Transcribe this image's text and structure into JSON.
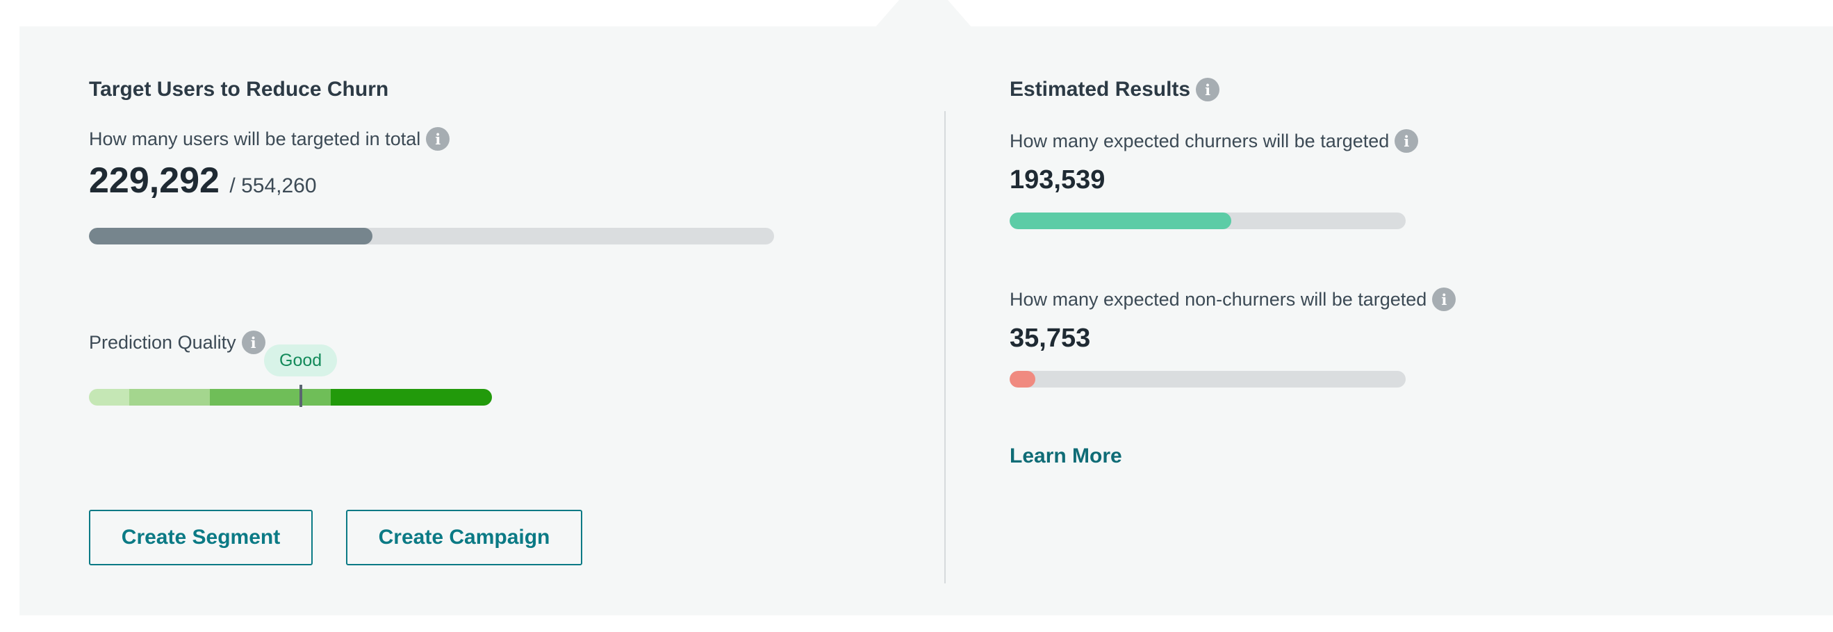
{
  "left": {
    "title": "Target Users to Reduce Churn",
    "targeted_label": "How many users will be targeted in total",
    "targeted_value": "229,292",
    "targeted_total": "/ 554,260",
    "targeted_fraction": 0.414,
    "quality_label": "Prediction Quality",
    "quality_badge": "Good",
    "quality_level": 0.525,
    "quality_segments": [
      "#c5e7b5",
      "#a4d68e",
      "#6fbe58",
      "#229a0b"
    ],
    "create_segment_label": "Create Segment",
    "create_campaign_label": "Create Campaign"
  },
  "right": {
    "title": "Estimated Results",
    "churners_label": "How many expected churners will be targeted",
    "churners_value": "193,539",
    "churners_fraction": 0.56,
    "nonchurners_label": "How many expected non-churners will be targeted",
    "nonchurners_value": "35,753",
    "nonchurners_fraction": 0.065,
    "learn_more_label": "Learn More"
  },
  "colors": {
    "panel_bg": "#f5f7f7",
    "targeted_fill": "#76858d",
    "churners_fill": "#5ccca6",
    "nonchurners_fill": "#f08a80",
    "accent": "#0b7a85"
  }
}
